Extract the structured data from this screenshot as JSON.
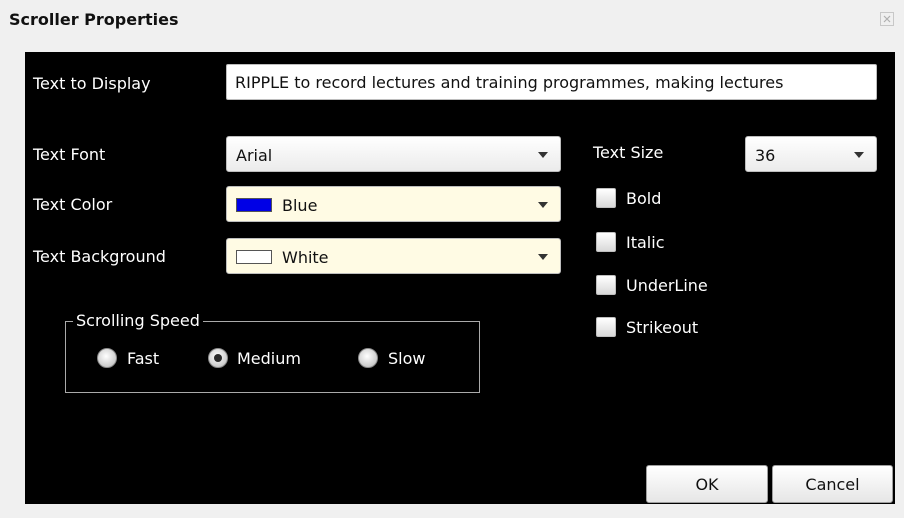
{
  "window": {
    "title": "Scroller Properties",
    "close_icon": "close-icon"
  },
  "fields": {
    "text_to_display": {
      "label": "Text to Display",
      "value": "RIPPLE to record lectures and training programmes, making lectures"
    },
    "text_font": {
      "label": "Text Font",
      "selected": "Arial"
    },
    "text_color": {
      "label": "Text Color",
      "selected": "Blue",
      "swatch": "#0000e6"
    },
    "text_background": {
      "label": "Text Background",
      "selected": "White",
      "swatch": "#ffffff"
    },
    "text_size": {
      "label": "Text Size",
      "selected": "36"
    }
  },
  "styles": {
    "bold": {
      "label": "Bold",
      "checked": false
    },
    "italic": {
      "label": "Italic",
      "checked": false
    },
    "underline": {
      "label": "UnderLine",
      "checked": false
    },
    "strikeout": {
      "label": "Strikeout",
      "checked": false
    }
  },
  "scrolling_speed": {
    "legend": "Scrolling Speed",
    "options": [
      {
        "label": "Fast",
        "checked": false
      },
      {
        "label": "Medium",
        "checked": true
      },
      {
        "label": "Slow",
        "checked": false
      }
    ]
  },
  "buttons": {
    "ok": "OK",
    "cancel": "Cancel"
  },
  "colors": {
    "content_bg": "#000000",
    "chrome_bg": "#f0f0f0",
    "label_text": "#ffffff"
  }
}
